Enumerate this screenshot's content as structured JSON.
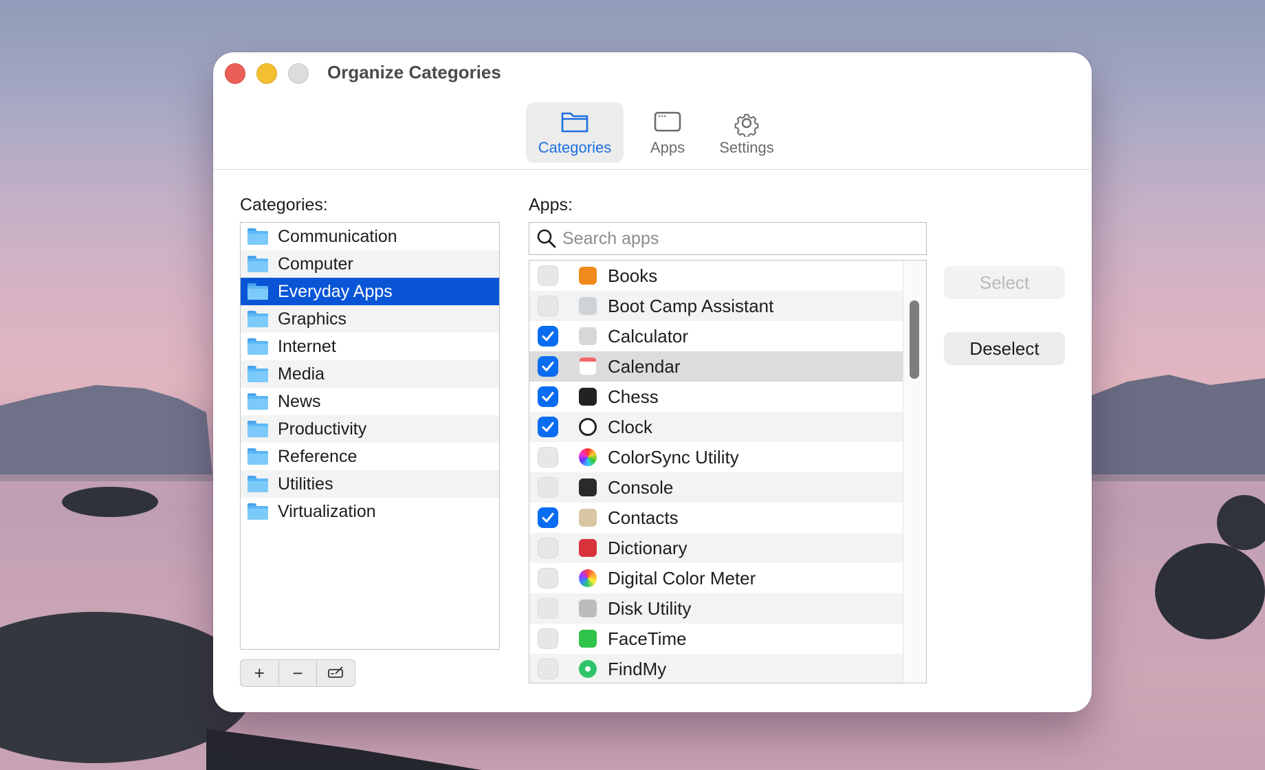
{
  "window": {
    "title": "Organize Categories"
  },
  "toolbar": {
    "tabs": [
      {
        "label": "Categories",
        "icon": "folder-icon",
        "active": true
      },
      {
        "label": "Apps",
        "icon": "window-icon",
        "active": false
      },
      {
        "label": "Settings",
        "icon": "gear-icon",
        "active": false
      }
    ]
  },
  "categories": {
    "label": "Categories:",
    "items": [
      "Communication",
      "Computer",
      "Everyday Apps",
      "Graphics",
      "Internet",
      "Media",
      "News",
      "Productivity",
      "Reference",
      "Utilities",
      "Virtualization"
    ],
    "selected": "Everyday Apps",
    "buttons": {
      "add": "+",
      "remove": "−",
      "edit": "edit-icon"
    }
  },
  "apps": {
    "label": "Apps:",
    "search_placeholder": "Search apps",
    "items": [
      {
        "name": "Books",
        "checked": false,
        "icon": "books-icon"
      },
      {
        "name": "Boot Camp Assistant",
        "checked": false,
        "icon": "bootcamp-icon"
      },
      {
        "name": "Calculator",
        "checked": true,
        "icon": "calculator-icon"
      },
      {
        "name": "Calendar",
        "checked": true,
        "icon": "calendar-icon"
      },
      {
        "name": "Chess",
        "checked": true,
        "icon": "chess-icon"
      },
      {
        "name": "Clock",
        "checked": true,
        "icon": "clock-icon"
      },
      {
        "name": "ColorSync Utility",
        "checked": false,
        "icon": "colorsync-icon"
      },
      {
        "name": "Console",
        "checked": false,
        "icon": "console-icon"
      },
      {
        "name": "Contacts",
        "checked": true,
        "icon": "contacts-icon"
      },
      {
        "name": "Dictionary",
        "checked": false,
        "icon": "dictionary-icon"
      },
      {
        "name": "Digital Color Meter",
        "checked": false,
        "icon": "color-meter-icon"
      },
      {
        "name": "Disk Utility",
        "checked": false,
        "icon": "disk-utility-icon"
      },
      {
        "name": "FaceTime",
        "checked": false,
        "icon": "facetime-icon"
      },
      {
        "name": "FindMy",
        "checked": false,
        "icon": "findmy-icon"
      }
    ],
    "highlighted": "Calendar"
  },
  "actions": {
    "select": "Select",
    "deselect": "Deselect"
  },
  "colors": {
    "accent": "#0a6cf0",
    "selection": "#0a55d6",
    "tab_active": "#1b6fe2"
  }
}
